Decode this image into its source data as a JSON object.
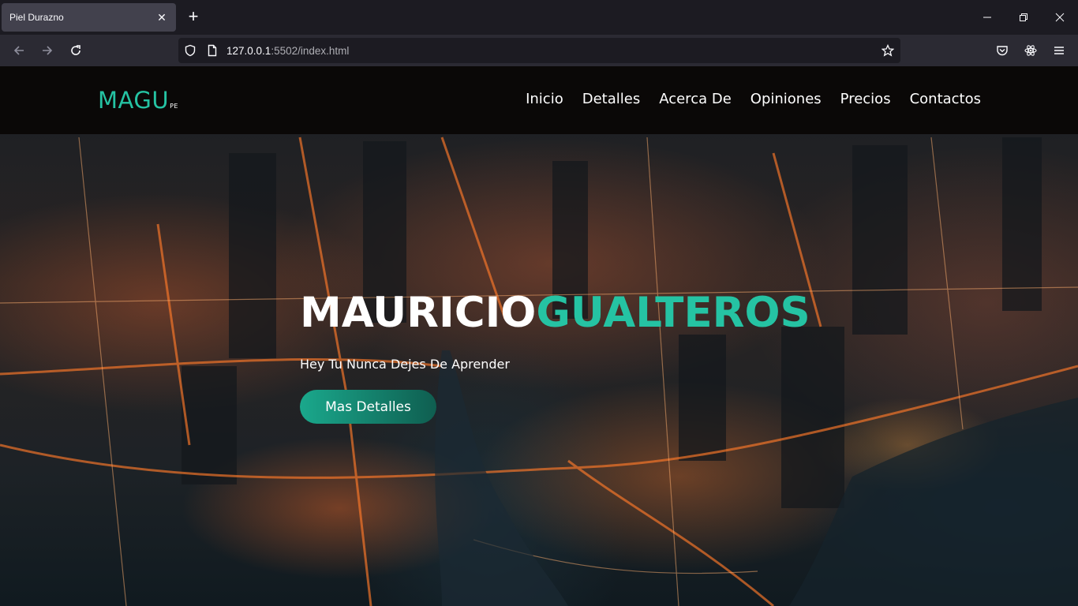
{
  "browser": {
    "tab_title": "Piel Durazno",
    "url_host": "127.0.0.1",
    "url_rest": ":5502/index.html"
  },
  "site": {
    "logo_main": "MAGU",
    "logo_sub": "PE",
    "nav": [
      "Inicio",
      "Detalles",
      "Acerca De",
      "Opiniones",
      "Precios",
      "Contactos"
    ],
    "headline_white": "MAURICIO",
    "headline_green": "GUALTEROS",
    "tagline": "Hey Tu Nunca Dejes De Aprender",
    "cta_label": "Mas Detalles"
  },
  "colors": {
    "accent": "#25c3a3",
    "nav_bg": "#0a0807",
    "chrome_bg": "#1c1b22"
  }
}
